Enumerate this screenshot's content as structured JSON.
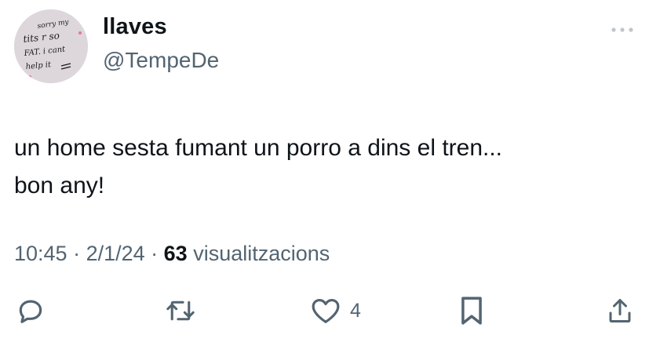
{
  "user": {
    "display_name": "llaves",
    "handle": "@TempeDe",
    "avatar_text": [
      "sorry my",
      "tits r so",
      "FAT. i cant",
      "help it"
    ]
  },
  "tweet": {
    "lines": [
      "un home sesta fumant un porro a dins el tren...",
      "bon any!"
    ]
  },
  "meta": {
    "time": "10:45",
    "sep1": " · ",
    "date": "2/1/24",
    "sep2": " · ",
    "views_count": "63",
    "views_label": " visualitzacions"
  },
  "actions": {
    "reply_icon": "reply-icon",
    "retweet_icon": "retweet-icon",
    "like_icon": "heart-icon",
    "like_count": "4",
    "bookmark_icon": "bookmark-icon",
    "share_icon": "share-icon"
  },
  "colors": {
    "text": "#0f1419",
    "secondary": "#536471",
    "background": "#ffffff"
  }
}
